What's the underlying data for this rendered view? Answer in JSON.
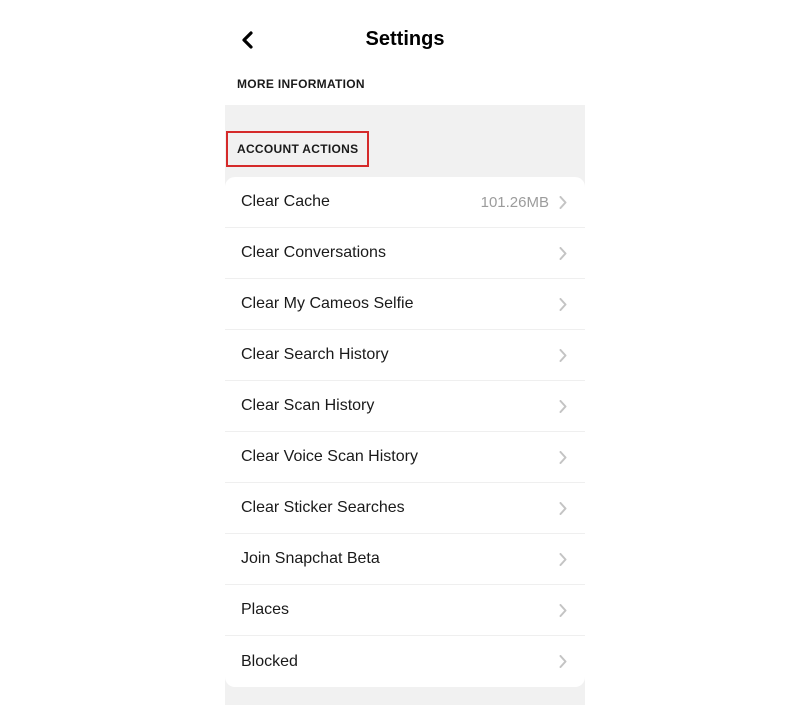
{
  "header": {
    "title": "Settings"
  },
  "more_info_label": "MORE INFORMATION",
  "section_title": "ACCOUNT ACTIONS",
  "rows": [
    {
      "label": "Clear Cache",
      "value": "101.26MB"
    },
    {
      "label": "Clear Conversations",
      "value": ""
    },
    {
      "label": "Clear My Cameos Selfie",
      "value": ""
    },
    {
      "label": "Clear Search History",
      "value": ""
    },
    {
      "label": "Clear Scan History",
      "value": ""
    },
    {
      "label": "Clear Voice Scan History",
      "value": ""
    },
    {
      "label": "Clear Sticker Searches",
      "value": ""
    },
    {
      "label": "Join Snapchat Beta",
      "value": ""
    },
    {
      "label": "Places",
      "value": ""
    },
    {
      "label": "Blocked",
      "value": ""
    }
  ]
}
